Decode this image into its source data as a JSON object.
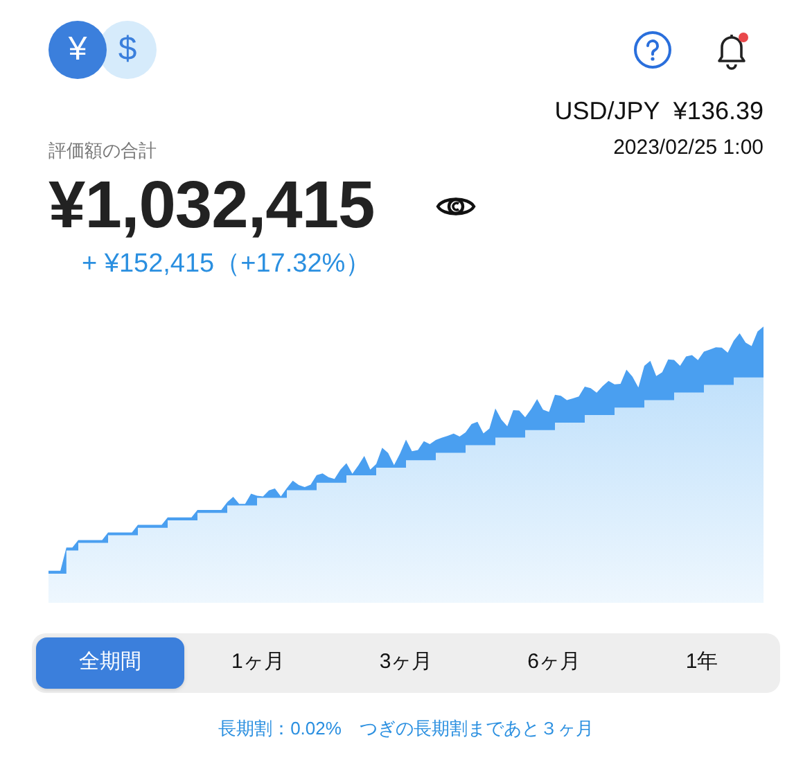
{
  "currency_toggle": [
    {
      "symbol": "¥",
      "selected": true
    },
    {
      "symbol": "$",
      "selected": false
    }
  ],
  "notifications": {
    "unread": true
  },
  "rate": {
    "pair": "USD/JPY",
    "value": "¥136.39",
    "timestamp": "2023/02/25 1:00"
  },
  "total": {
    "label": "評価額の合計",
    "amount": "¥1,032,415",
    "change": "+ ¥152,415（+17.32%）"
  },
  "period_tabs": [
    {
      "label": "全期間",
      "selected": true
    },
    {
      "label": "1ヶ月",
      "selected": false
    },
    {
      "label": "3ヶ月",
      "selected": false
    },
    {
      "label": "6ヶ月",
      "selected": false
    },
    {
      "label": "1年",
      "selected": false
    }
  ],
  "footer": "長期割：0.02%　つぎの長期割まであと３ヶ月"
}
